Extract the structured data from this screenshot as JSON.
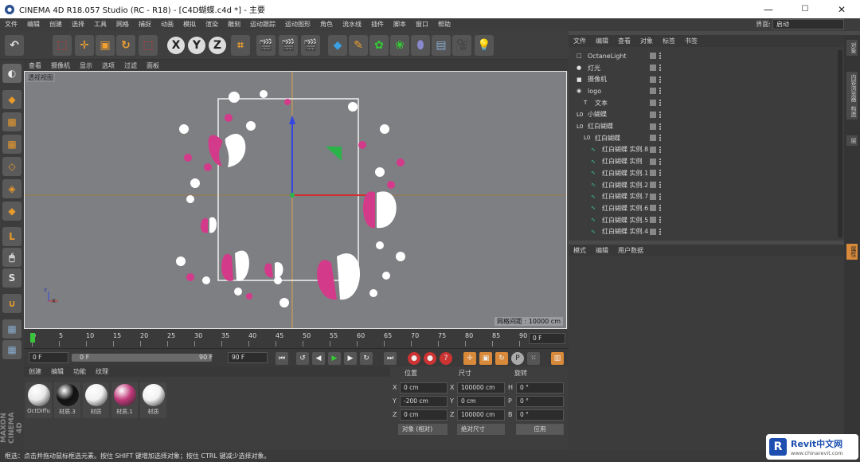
{
  "window": {
    "title": "CINEMA 4D R18.057 Studio (RC - R18) - [C4D蝴蝶.c4d *] - 主要",
    "minimize": "—",
    "maximize": "☐",
    "close": "✕"
  },
  "menu": [
    "文件",
    "编辑",
    "创建",
    "选择",
    "工具",
    "网格",
    "捕捉",
    "动画",
    "模拟",
    "渲染",
    "雕刻",
    "运动跟踪",
    "运动图形",
    "角色",
    "流水线",
    "插件",
    "脚本",
    "窗口",
    "帮助"
  ],
  "layout": {
    "label": "界面:",
    "value": "启动"
  },
  "viewport": {
    "menu": [
      "查看",
      "摄像机",
      "显示",
      "选项",
      "过滤",
      "面板"
    ],
    "label": "透视视图",
    "grid": "网格间距 : 10000 cm",
    "axis_y": "Y",
    "axis_x": "X"
  },
  "timeline": {
    "ticks": [
      "0",
      "5",
      "10",
      "15",
      "20",
      "25",
      "30",
      "35",
      "40",
      "45",
      "50",
      "55",
      "60",
      "65",
      "70",
      "75",
      "80",
      "85",
      "90"
    ],
    "frame": "0 F"
  },
  "transport": {
    "start": "0 F",
    "range_start": "0 F",
    "range_end": "90 F",
    "end": "90 F"
  },
  "materials": {
    "menu": [
      "创建",
      "编辑",
      "功能",
      "纹理"
    ],
    "items": [
      {
        "name": "OctDiffu",
        "color": "#e8e8e8"
      },
      {
        "name": "材质.3",
        "color": "#111111"
      },
      {
        "name": "材质",
        "color": "#f0f0f0"
      },
      {
        "name": "材质.1",
        "color": "#c0387a"
      },
      {
        "name": "材质",
        "color": "#f2f2f2"
      }
    ]
  },
  "coords": {
    "headers": [
      "位置",
      "尺寸",
      "旋转"
    ],
    "rows": [
      {
        "axis": "X",
        "pos": "0 cm",
        "size_axis": "X",
        "size": "100000 cm",
        "rot_axis": "H",
        "rot": "0 °"
      },
      {
        "axis": "Y",
        "pos": "-200 cm",
        "size_axis": "Y",
        "size": "0 cm",
        "rot_axis": "P",
        "rot": "0 °"
      },
      {
        "axis": "Z",
        "pos": "0 cm",
        "size_axis": "Z",
        "size": "100000 cm",
        "rot_axis": "B",
        "rot": "0 °"
      }
    ],
    "mode": "对象 (相对)",
    "size_mode": "绝对尺寸",
    "apply": "应用"
  },
  "objects": {
    "menu": [
      "文件",
      "编辑",
      "查看",
      "对象",
      "标签",
      "书签"
    ],
    "items": [
      {
        "name": "OctaneLight",
        "indent": 0,
        "icon": "□"
      },
      {
        "name": "灯光",
        "indent": 0,
        "icon": "●"
      },
      {
        "name": "摄像机",
        "indent": 0,
        "icon": "■"
      },
      {
        "name": "logo",
        "indent": 0,
        "icon": "◉"
      },
      {
        "name": "文本",
        "indent": 1,
        "icon": "T"
      },
      {
        "name": "小蝴蝶",
        "indent": 0,
        "icon": "L0"
      },
      {
        "name": "红白蝴蝶",
        "indent": 0,
        "icon": "L0"
      },
      {
        "name": "红白蝴蝶",
        "indent": 1,
        "icon": "L0"
      },
      {
        "name": "红白蝴蝶 实例.8",
        "indent": 2,
        "icon": "∿"
      },
      {
        "name": "红白蝴蝶 实例",
        "indent": 2,
        "icon": "∿"
      },
      {
        "name": "红白蝴蝶 实例.1",
        "indent": 2,
        "icon": "∿"
      },
      {
        "name": "红白蝴蝶 实例.2",
        "indent": 2,
        "icon": "∿"
      },
      {
        "name": "红白蝴蝶 实例.7",
        "indent": 2,
        "icon": "∿"
      },
      {
        "name": "红白蝴蝶 实例.6",
        "indent": 2,
        "icon": "∿"
      },
      {
        "name": "红白蝴蝶 实例.5",
        "indent": 2,
        "icon": "∿"
      },
      {
        "name": "红白蝴蝶 实例.4",
        "indent": 2,
        "icon": "∿"
      }
    ]
  },
  "attributes": {
    "menu": [
      "模式",
      "编辑",
      "用户数据"
    ]
  },
  "right_tabs": [
    "对象",
    "内容浏览器",
    "构造",
    "层"
  ],
  "right_tab_bottom": "属性",
  "status": "框选：点击并拖动鼠标框选元素。按住 SHIFT 键增加选择对象；按住 CTRL 键减少选择对象。",
  "brand": "MAXON CINEMA 4D",
  "watermark": {
    "logo": "R",
    "name": "Revit中文网",
    "url": "www.chinarevit.com"
  }
}
